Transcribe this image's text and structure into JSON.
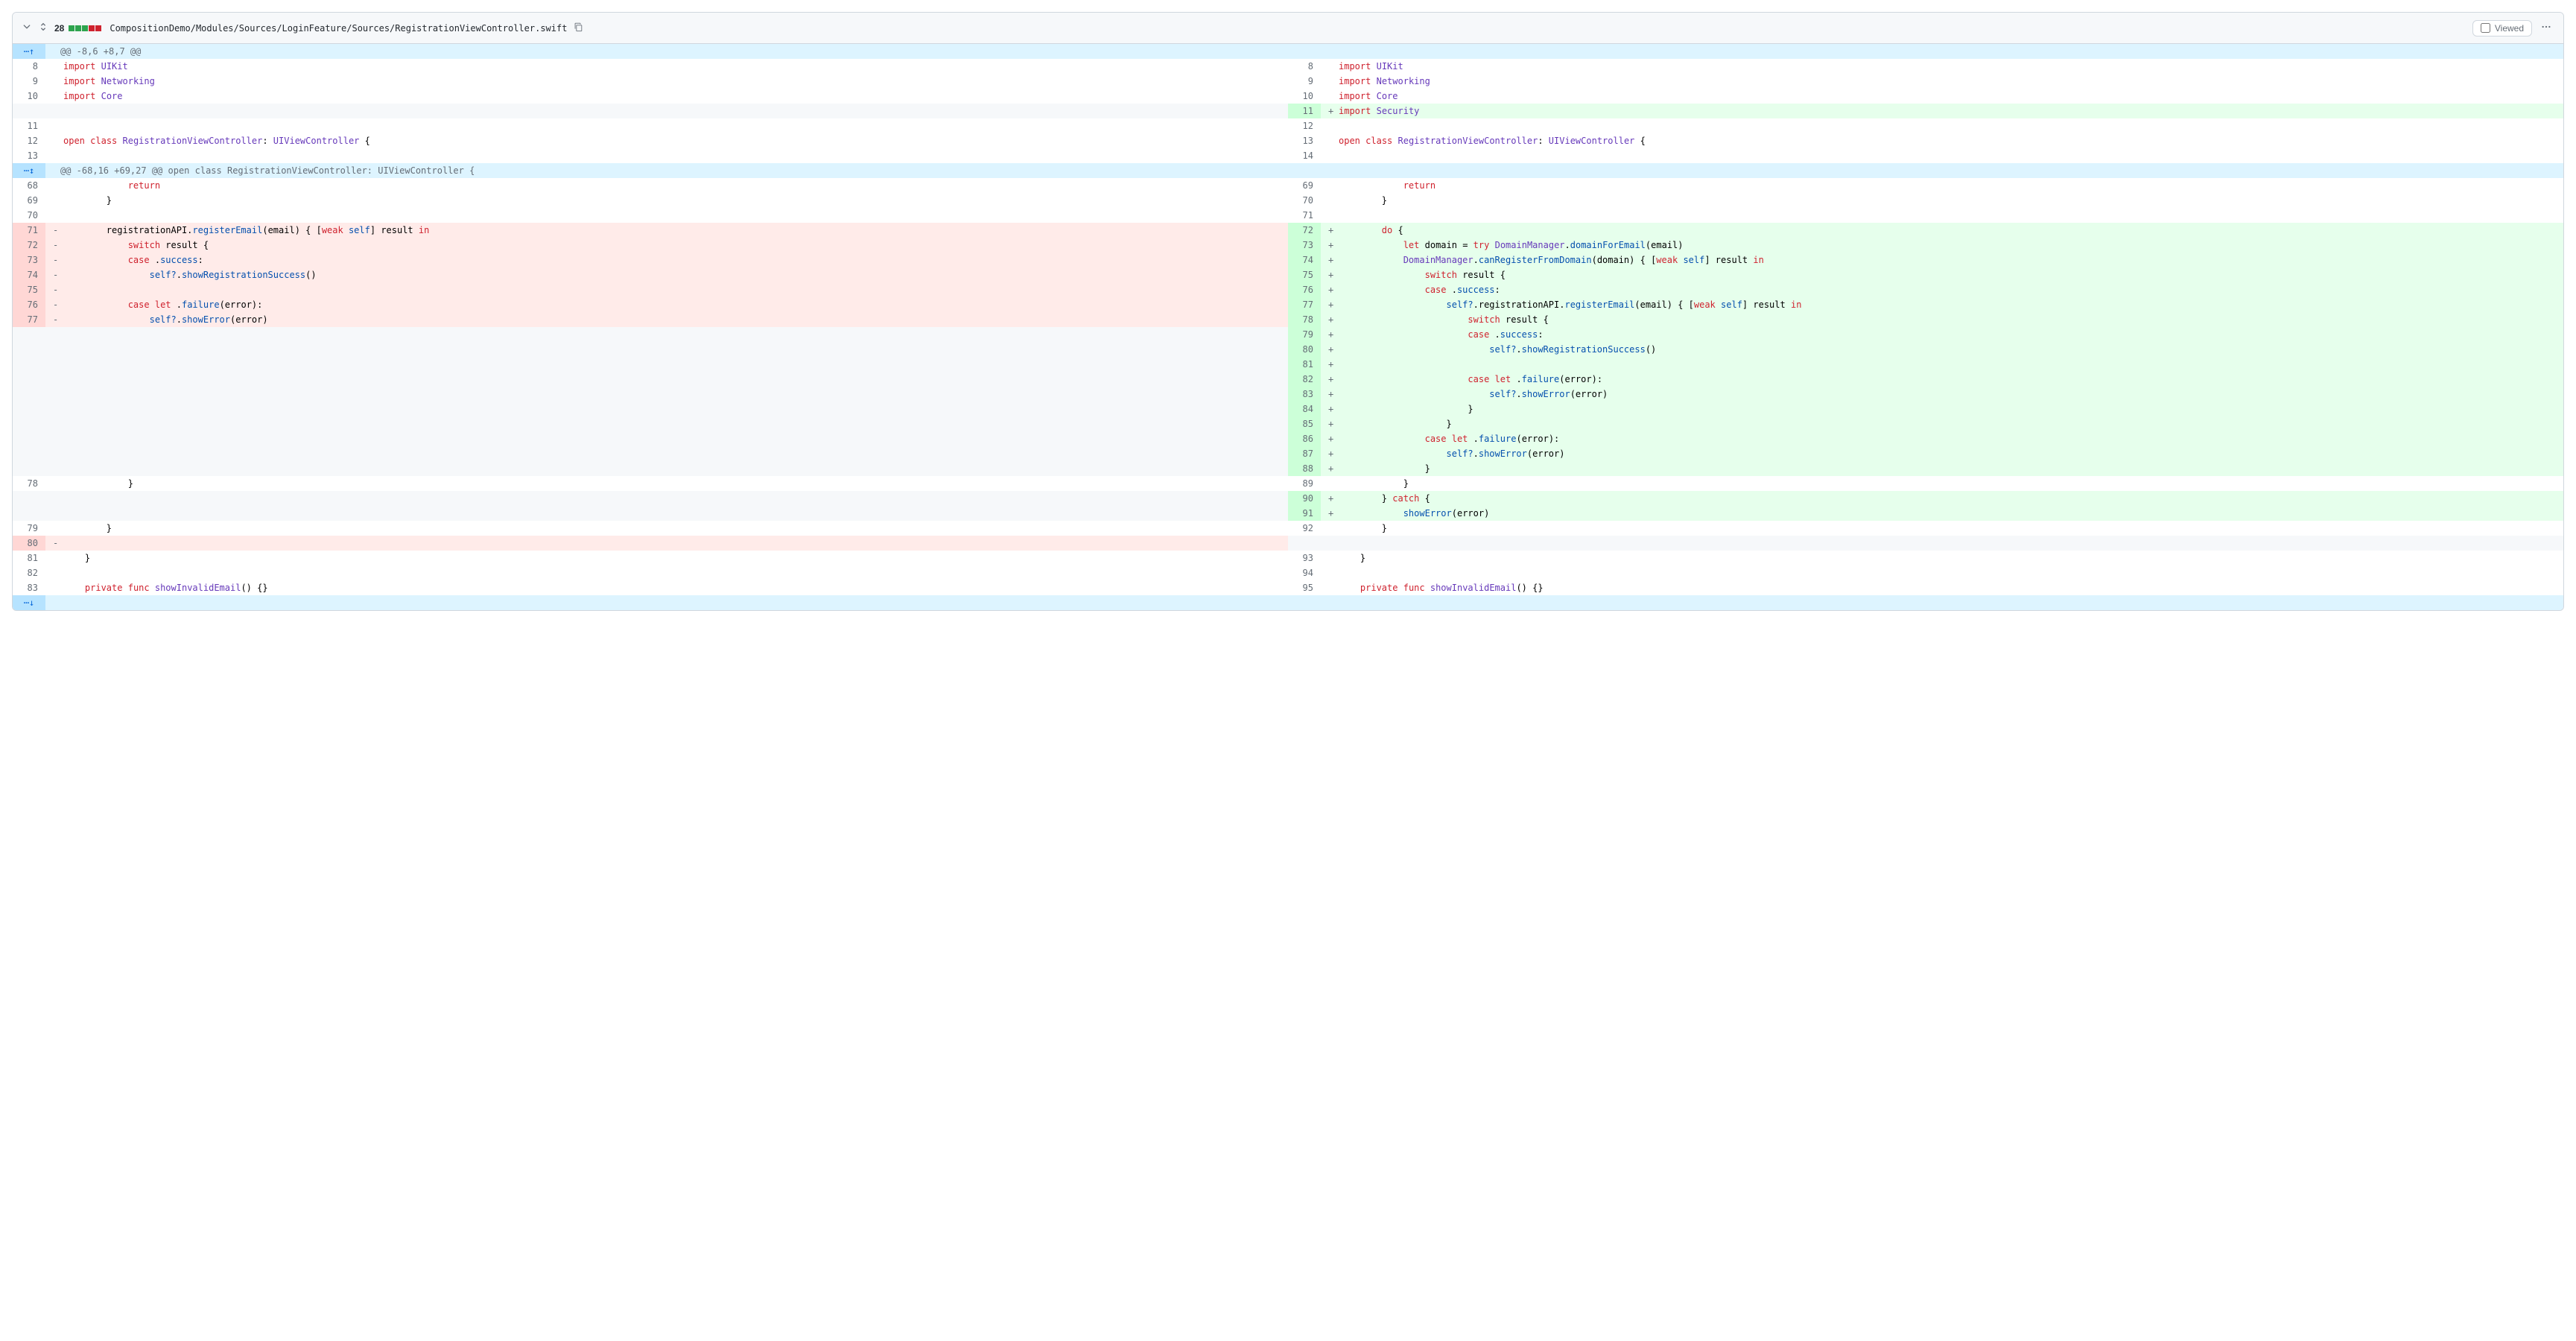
{
  "header": {
    "change_count": "28",
    "file_path": "CompositionDemo/Modules/Sources/LoginFeature/Sources/RegistrationViewController.swift",
    "viewed_label": "Viewed"
  },
  "hunks": {
    "h1": "@@ -8,6 +8,7 @@",
    "h2": "@@ -68,16 +69,27 @@ open class RegistrationViewController: UIViewController {"
  },
  "lineNums": {
    "l8": "8",
    "l9": "9",
    "l10": "10",
    "l11": "11",
    "l12": "12",
    "l13": "13",
    "l68": "68",
    "l69": "69",
    "l70": "70",
    "l71": "71",
    "l72": "72",
    "l73": "73",
    "l74": "74",
    "l75": "75",
    "l76": "76",
    "l77": "77",
    "l78": "78",
    "l79": "79",
    "l80": "80",
    "l81": "81",
    "l82": "82",
    "l83": "83",
    "r8": "8",
    "r9": "9",
    "r10": "10",
    "r11": "11",
    "r12": "12",
    "r13": "13",
    "r14": "14",
    "r69": "69",
    "r70": "70",
    "r71": "71",
    "r72": "72",
    "r73": "73",
    "r74": "74",
    "r75": "75",
    "r76": "76",
    "r77": "77",
    "r78": "78",
    "r79": "79",
    "r80": "80",
    "r81": "81",
    "r82": "82",
    "r83": "83",
    "r84": "84",
    "r85": "85",
    "r86": "86",
    "r87": "87",
    "r88": "88",
    "r89": "89",
    "r90": "90",
    "r91": "91",
    "r92": "92",
    "r93": "93",
    "r94": "94",
    "r95": "95"
  },
  "tokens": {
    "import": "import",
    "UIKit": "UIKit",
    "Networking": "Networking",
    "Core": "Core",
    "Security": "Security",
    "open": "open",
    "class": "class",
    "RegistrationViewController": "RegistrationViewController",
    "UIViewController": "UIViewController",
    "return": "return",
    "registrationAPI": "registrationAPI",
    "registerEmail": "registerEmail",
    "weak": "weak",
    "self": "self",
    "selfq": "self?",
    "result": "result",
    "in": "in",
    "switch": "switch",
    "case": "case",
    "success": "success",
    "failure": "failure",
    "showRegistrationSuccess": "showRegistrationSuccess",
    "let": "let",
    "error": "error",
    "showError": "showError",
    "do": "do",
    "domain": "domain",
    "try": "try",
    "DomainManager": "DomainManager",
    "domainForEmail": "domainForEmail",
    "canRegisterFromDomain": "canRegisterFromDomain",
    "email": "email",
    "catch": "catch",
    "private": "private",
    "func": "func",
    "showInvalidEmail": "showInvalidEmail"
  }
}
